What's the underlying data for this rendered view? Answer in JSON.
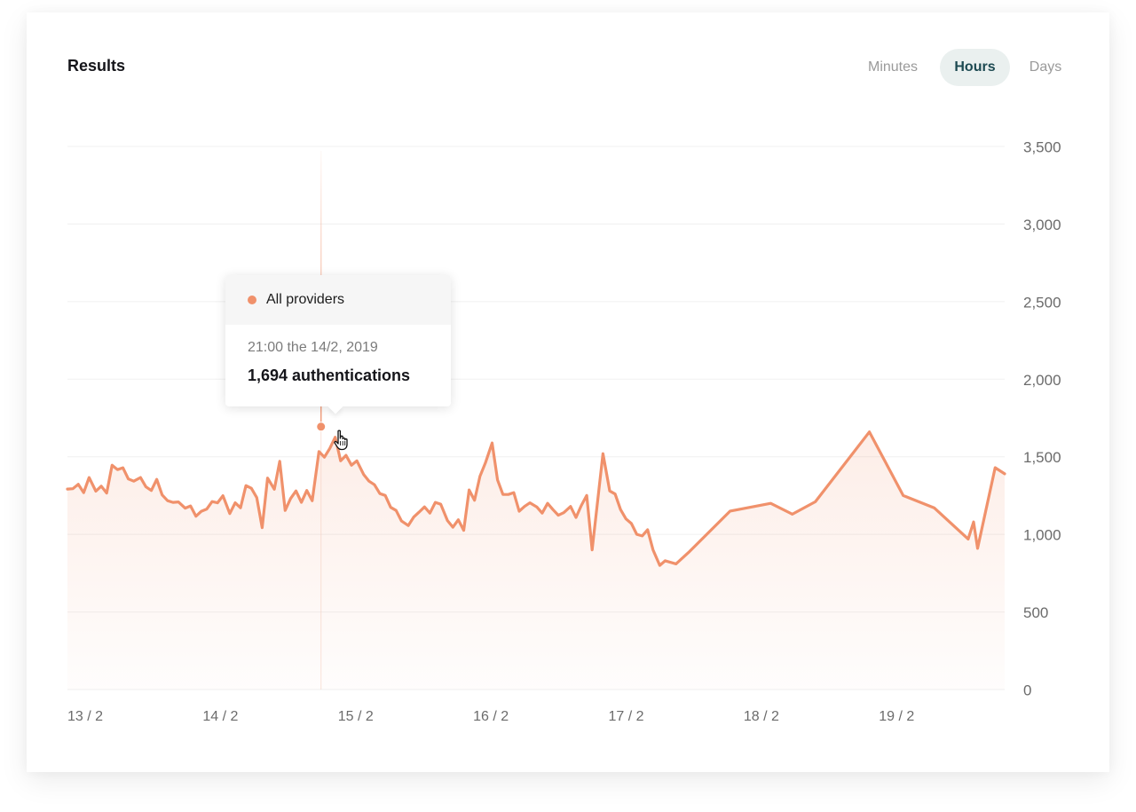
{
  "panel": {
    "title": "Results",
    "tabs": [
      {
        "label": "Minutes",
        "active": false
      },
      {
        "label": "Hours",
        "active": true
      },
      {
        "label": "Days",
        "active": false
      }
    ]
  },
  "tooltip": {
    "series_name": "All providers",
    "time": "21:00 the 14/2, 2019",
    "value_text": "1,694 authentications"
  },
  "colors": {
    "line": "#f0916b",
    "grid": "#f0f0f0",
    "axis_text": "#6b6b6b",
    "active_tab_bg": "#eaf0ef"
  },
  "icons": {
    "cursor": "hand-pointer-icon"
  },
  "chart_data": {
    "type": "area",
    "x_tick_labels": [
      "13 / 2",
      "14 / 2",
      "15 / 2",
      "16 / 2",
      "17 / 2",
      "18 / 2",
      "19 / 2"
    ],
    "y_tick_labels": [
      "0",
      "500",
      "1,000",
      "1,500",
      "2,000",
      "2,500",
      "3,000",
      "3,500"
    ],
    "y_ticks": [
      0,
      500,
      1000,
      1500,
      2000,
      2500,
      3000,
      3500
    ],
    "ylim": [
      0,
      3500
    ],
    "x_unit": "days since 13/2",
    "xlim": [
      0,
      6.93
    ],
    "grid": true,
    "y_axis_position": "right",
    "highlight": {
      "x": 1.875,
      "y": 1694
    },
    "series": [
      {
        "name": "All providers",
        "points": [
          [
            0.0,
            1292
          ],
          [
            0.04,
            1294
          ],
          [
            0.08,
            1323
          ],
          [
            0.12,
            1269
          ],
          [
            0.16,
            1366
          ],
          [
            0.21,
            1278
          ],
          [
            0.25,
            1311
          ],
          [
            0.29,
            1266
          ],
          [
            0.33,
            1446
          ],
          [
            0.37,
            1417
          ],
          [
            0.41,
            1429
          ],
          [
            0.45,
            1357
          ],
          [
            0.49,
            1343
          ],
          [
            0.54,
            1366
          ],
          [
            0.58,
            1306
          ],
          [
            0.62,
            1283
          ],
          [
            0.66,
            1354
          ],
          [
            0.7,
            1254
          ],
          [
            0.74,
            1217
          ],
          [
            0.78,
            1206
          ],
          [
            0.82,
            1209
          ],
          [
            0.87,
            1169
          ],
          [
            0.91,
            1183
          ],
          [
            0.95,
            1117
          ],
          [
            0.99,
            1149
          ],
          [
            1.03,
            1163
          ],
          [
            1.07,
            1211
          ],
          [
            1.11,
            1203
          ],
          [
            1.15,
            1249
          ],
          [
            1.2,
            1134
          ],
          [
            1.24,
            1203
          ],
          [
            1.28,
            1171
          ],
          [
            1.32,
            1314
          ],
          [
            1.36,
            1297
          ],
          [
            1.4,
            1237
          ],
          [
            1.44,
            1043
          ],
          [
            1.48,
            1363
          ],
          [
            1.53,
            1291
          ],
          [
            1.57,
            1471
          ],
          [
            1.61,
            1154
          ],
          [
            1.65,
            1231
          ],
          [
            1.69,
            1280
          ],
          [
            1.73,
            1206
          ],
          [
            1.77,
            1283
          ],
          [
            1.81,
            1217
          ],
          [
            1.86,
            1534
          ],
          [
            1.9,
            1497
          ],
          [
            1.94,
            1554
          ],
          [
            1.98,
            1626
          ],
          [
            2.02,
            1474
          ],
          [
            2.06,
            1509
          ],
          [
            2.1,
            1446
          ],
          [
            2.14,
            1474
          ],
          [
            2.19,
            1386
          ],
          [
            2.23,
            1343
          ],
          [
            2.27,
            1320
          ],
          [
            2.31,
            1263
          ],
          [
            2.35,
            1251
          ],
          [
            2.39,
            1174
          ],
          [
            2.43,
            1154
          ],
          [
            2.47,
            1086
          ],
          [
            2.52,
            1057
          ],
          [
            2.56,
            1111
          ],
          [
            2.6,
            1143
          ],
          [
            2.64,
            1177
          ],
          [
            2.68,
            1137
          ],
          [
            2.72,
            1206
          ],
          [
            2.76,
            1194
          ],
          [
            2.81,
            1089
          ],
          [
            2.85,
            1046
          ],
          [
            2.89,
            1094
          ],
          [
            2.93,
            1026
          ],
          [
            2.97,
            1286
          ],
          [
            3.01,
            1220
          ],
          [
            3.05,
            1374
          ],
          [
            3.09,
            1460
          ],
          [
            3.14,
            1589
          ],
          [
            3.18,
            1351
          ],
          [
            3.22,
            1257
          ],
          [
            3.26,
            1257
          ],
          [
            3.3,
            1269
          ],
          [
            3.34,
            1149
          ],
          [
            3.38,
            1180
          ],
          [
            3.42,
            1203
          ],
          [
            3.47,
            1177
          ],
          [
            3.51,
            1137
          ],
          [
            3.55,
            1200
          ],
          [
            3.59,
            1160
          ],
          [
            3.63,
            1123
          ],
          [
            3.67,
            1140
          ],
          [
            3.72,
            1180
          ],
          [
            3.76,
            1109
          ],
          [
            3.8,
            1186
          ],
          [
            3.84,
            1251
          ],
          [
            3.88,
            900
          ],
          [
            3.96,
            1520
          ],
          [
            4.01,
            1280
          ],
          [
            4.05,
            1260
          ],
          [
            4.09,
            1160
          ],
          [
            4.13,
            1100
          ],
          [
            4.17,
            1070
          ],
          [
            4.21,
            1000
          ],
          [
            4.25,
            990
          ],
          [
            4.29,
            1030
          ],
          [
            4.33,
            900
          ],
          [
            4.38,
            800
          ],
          [
            4.42,
            830
          ],
          [
            4.5,
            810
          ],
          [
            4.6,
            890
          ],
          [
            4.9,
            1150
          ],
          [
            5.2,
            1200
          ],
          [
            5.36,
            1130
          ],
          [
            5.53,
            1210
          ],
          [
            5.93,
            1660
          ],
          [
            6.18,
            1250
          ],
          [
            6.41,
            1170
          ],
          [
            6.66,
            970
          ],
          [
            6.7,
            1080
          ],
          [
            6.73,
            910
          ],
          [
            6.86,
            1430
          ],
          [
            6.93,
            1390
          ]
        ]
      }
    ]
  }
}
